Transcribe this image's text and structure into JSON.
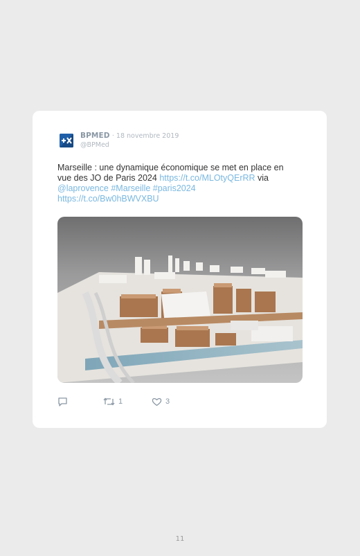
{
  "tweet": {
    "author_name": "BPMED",
    "date": "· 18 novembre 2019",
    "handle": "@BPMed",
    "text_line1": "Marseille : une dynamique économique se met en place en",
    "text_line2_prefix": "vue des JO de Paris 2024 ",
    "link1": "https://t.co/MLOtyQErRR",
    "text_via": " via",
    "mention": "@laprovence",
    "hashtag1": "#Marseille",
    "hashtag2": "#paris2024",
    "link2": "https://t.co/Bw0hBWVXBU",
    "retweet_count": "1",
    "like_count": "3"
  },
  "page": {
    "number": "11"
  },
  "colors": {
    "link": "#7ab8e0",
    "muted": "#8a97a4",
    "avatar": "#1f5fa8"
  },
  "icons": {
    "reply": "reply-icon",
    "retweet": "retweet-icon",
    "like": "heart-icon"
  }
}
